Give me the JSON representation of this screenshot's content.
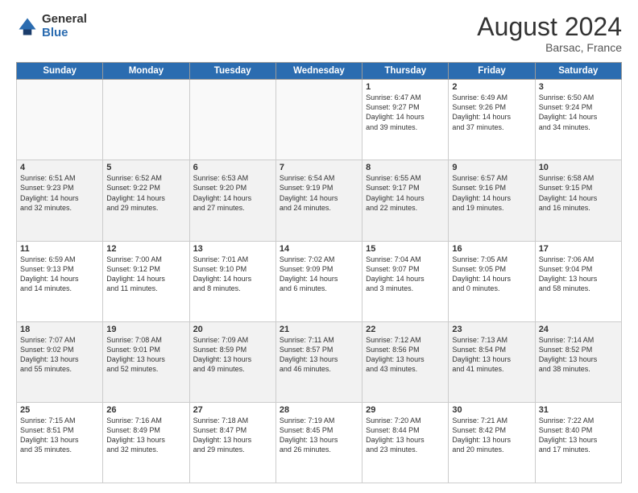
{
  "header": {
    "logo_general": "General",
    "logo_blue": "Blue",
    "month_title": "August 2024",
    "location": "Barsac, France"
  },
  "days_of_week": [
    "Sunday",
    "Monday",
    "Tuesday",
    "Wednesday",
    "Thursday",
    "Friday",
    "Saturday"
  ],
  "weeks": [
    [
      {
        "day": "",
        "detail": "",
        "empty": true
      },
      {
        "day": "",
        "detail": "",
        "empty": true
      },
      {
        "day": "",
        "detail": "",
        "empty": true
      },
      {
        "day": "",
        "detail": "",
        "empty": true
      },
      {
        "day": "1",
        "detail": "Sunrise: 6:47 AM\nSunset: 9:27 PM\nDaylight: 14 hours\nand 39 minutes."
      },
      {
        "day": "2",
        "detail": "Sunrise: 6:49 AM\nSunset: 9:26 PM\nDaylight: 14 hours\nand 37 minutes."
      },
      {
        "day": "3",
        "detail": "Sunrise: 6:50 AM\nSunset: 9:24 PM\nDaylight: 14 hours\nand 34 minutes."
      }
    ],
    [
      {
        "day": "4",
        "detail": "Sunrise: 6:51 AM\nSunset: 9:23 PM\nDaylight: 14 hours\nand 32 minutes."
      },
      {
        "day": "5",
        "detail": "Sunrise: 6:52 AM\nSunset: 9:22 PM\nDaylight: 14 hours\nand 29 minutes."
      },
      {
        "day": "6",
        "detail": "Sunrise: 6:53 AM\nSunset: 9:20 PM\nDaylight: 14 hours\nand 27 minutes."
      },
      {
        "day": "7",
        "detail": "Sunrise: 6:54 AM\nSunset: 9:19 PM\nDaylight: 14 hours\nand 24 minutes."
      },
      {
        "day": "8",
        "detail": "Sunrise: 6:55 AM\nSunset: 9:17 PM\nDaylight: 14 hours\nand 22 minutes."
      },
      {
        "day": "9",
        "detail": "Sunrise: 6:57 AM\nSunset: 9:16 PM\nDaylight: 14 hours\nand 19 minutes."
      },
      {
        "day": "10",
        "detail": "Sunrise: 6:58 AM\nSunset: 9:15 PM\nDaylight: 14 hours\nand 16 minutes."
      }
    ],
    [
      {
        "day": "11",
        "detail": "Sunrise: 6:59 AM\nSunset: 9:13 PM\nDaylight: 14 hours\nand 14 minutes."
      },
      {
        "day": "12",
        "detail": "Sunrise: 7:00 AM\nSunset: 9:12 PM\nDaylight: 14 hours\nand 11 minutes."
      },
      {
        "day": "13",
        "detail": "Sunrise: 7:01 AM\nSunset: 9:10 PM\nDaylight: 14 hours\nand 8 minutes."
      },
      {
        "day": "14",
        "detail": "Sunrise: 7:02 AM\nSunset: 9:09 PM\nDaylight: 14 hours\nand 6 minutes."
      },
      {
        "day": "15",
        "detail": "Sunrise: 7:04 AM\nSunset: 9:07 PM\nDaylight: 14 hours\nand 3 minutes."
      },
      {
        "day": "16",
        "detail": "Sunrise: 7:05 AM\nSunset: 9:05 PM\nDaylight: 14 hours\nand 0 minutes."
      },
      {
        "day": "17",
        "detail": "Sunrise: 7:06 AM\nSunset: 9:04 PM\nDaylight: 13 hours\nand 58 minutes."
      }
    ],
    [
      {
        "day": "18",
        "detail": "Sunrise: 7:07 AM\nSunset: 9:02 PM\nDaylight: 13 hours\nand 55 minutes."
      },
      {
        "day": "19",
        "detail": "Sunrise: 7:08 AM\nSunset: 9:01 PM\nDaylight: 13 hours\nand 52 minutes."
      },
      {
        "day": "20",
        "detail": "Sunrise: 7:09 AM\nSunset: 8:59 PM\nDaylight: 13 hours\nand 49 minutes."
      },
      {
        "day": "21",
        "detail": "Sunrise: 7:11 AM\nSunset: 8:57 PM\nDaylight: 13 hours\nand 46 minutes."
      },
      {
        "day": "22",
        "detail": "Sunrise: 7:12 AM\nSunset: 8:56 PM\nDaylight: 13 hours\nand 43 minutes."
      },
      {
        "day": "23",
        "detail": "Sunrise: 7:13 AM\nSunset: 8:54 PM\nDaylight: 13 hours\nand 41 minutes."
      },
      {
        "day": "24",
        "detail": "Sunrise: 7:14 AM\nSunset: 8:52 PM\nDaylight: 13 hours\nand 38 minutes."
      }
    ],
    [
      {
        "day": "25",
        "detail": "Sunrise: 7:15 AM\nSunset: 8:51 PM\nDaylight: 13 hours\nand 35 minutes."
      },
      {
        "day": "26",
        "detail": "Sunrise: 7:16 AM\nSunset: 8:49 PM\nDaylight: 13 hours\nand 32 minutes."
      },
      {
        "day": "27",
        "detail": "Sunrise: 7:18 AM\nSunset: 8:47 PM\nDaylight: 13 hours\nand 29 minutes."
      },
      {
        "day": "28",
        "detail": "Sunrise: 7:19 AM\nSunset: 8:45 PM\nDaylight: 13 hours\nand 26 minutes."
      },
      {
        "day": "29",
        "detail": "Sunrise: 7:20 AM\nSunset: 8:44 PM\nDaylight: 13 hours\nand 23 minutes."
      },
      {
        "day": "30",
        "detail": "Sunrise: 7:21 AM\nSunset: 8:42 PM\nDaylight: 13 hours\nand 20 minutes."
      },
      {
        "day": "31",
        "detail": "Sunrise: 7:22 AM\nSunset: 8:40 PM\nDaylight: 13 hours\nand 17 minutes."
      }
    ]
  ]
}
